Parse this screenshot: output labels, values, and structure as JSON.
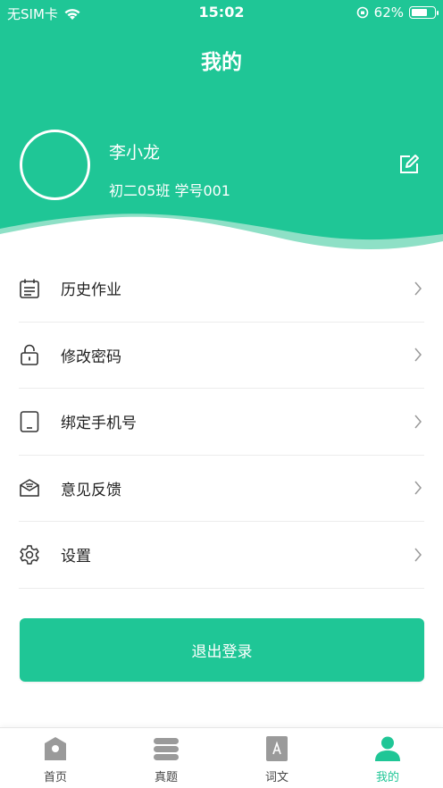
{
  "status_bar": {
    "carrier": "无SIM卡",
    "time": "15:02",
    "battery_percent": "62%",
    "battery_level": 0.62
  },
  "header": {
    "title": "我的",
    "color": "#1fc696"
  },
  "profile": {
    "name": "李小龙",
    "class_info": "初二05班 学号001",
    "avatar_icon": "avatar-circle",
    "edit_icon": "edit-icon"
  },
  "menu": [
    {
      "label": "历史作业",
      "icon": "calendar-icon"
    },
    {
      "label": "修改密码",
      "icon": "lock-icon"
    },
    {
      "label": "绑定手机号",
      "icon": "phone-icon"
    },
    {
      "label": "意见反馈",
      "icon": "mail-icon"
    },
    {
      "label": "设置",
      "icon": "gear-icon"
    }
  ],
  "logout_label": "退出登录",
  "tabs": [
    {
      "label": "首页",
      "icon": "home-icon",
      "active": false
    },
    {
      "label": "真题",
      "icon": "layers-icon",
      "active": false
    },
    {
      "label": "词文",
      "icon": "book-icon",
      "active": false
    },
    {
      "label": "我的",
      "icon": "person-icon",
      "active": true
    }
  ],
  "colors": {
    "accent": "#1fc696",
    "accent_light": "#7fdcbf",
    "inactive_icon": "#9a9a9a"
  }
}
